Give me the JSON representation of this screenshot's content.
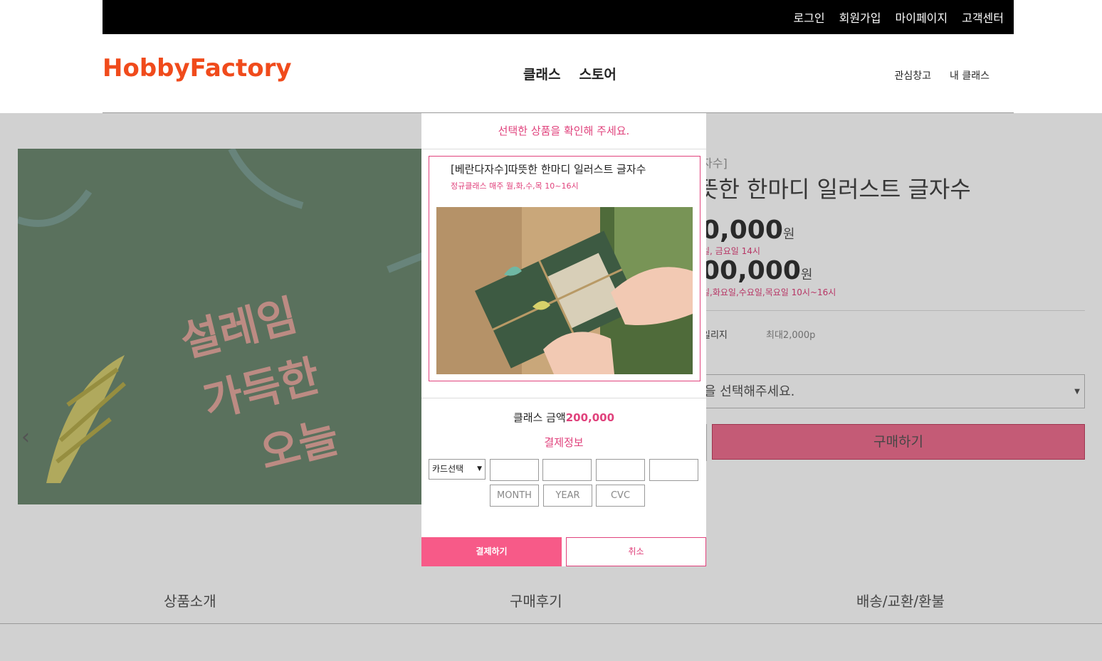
{
  "topbar": {
    "links": [
      "로그인",
      "회원가입",
      "마이페이지",
      "고객센터"
    ]
  },
  "header": {
    "logo": "HobbyFactory",
    "main_nav": [
      "클래스",
      "스토어"
    ],
    "sub_nav": [
      "관심창고",
      "내 클래스"
    ]
  },
  "product": {
    "category": "자수]",
    "title": "뜻한 한마디 일러스트 글자수",
    "price1": "0,000",
    "price1_unit": "원",
    "schedule1": "일, 금요일 14시",
    "price2": "00,000",
    "price2_unit": "원",
    "schedule2": "일,화요일,수요일,목요일 10시~16시",
    "mileage_label": "일리지",
    "mileage_value": "최대2,000p",
    "option_placeholder": "을 선택해주세요.",
    "buy_button": "구매하기"
  },
  "tabs": [
    "상품소개",
    "구매후기",
    "배송/교환/환불"
  ],
  "modal": {
    "header": "선택한 상품을 확인해 주세요.",
    "item_title": "[베란다자수]따뜻한 한마디 일러스트 글자수",
    "item_schedule": "정규클래스 매주 월,화,수,목 10~16시",
    "amount_label": "클래스 금액",
    "amount_value": "200,000",
    "pay_info": "결제정보",
    "card_select": "카드선택",
    "placeholders": {
      "month": "MONTH",
      "year": "YEAR",
      "cvc": "CVC"
    },
    "pay_button": "결제하기",
    "cancel_button": "취소"
  },
  "colors": {
    "accent": "#e0427c",
    "logo": "#f04b1c",
    "pay_button": "#f75a88",
    "buy_button": "#f07090"
  }
}
